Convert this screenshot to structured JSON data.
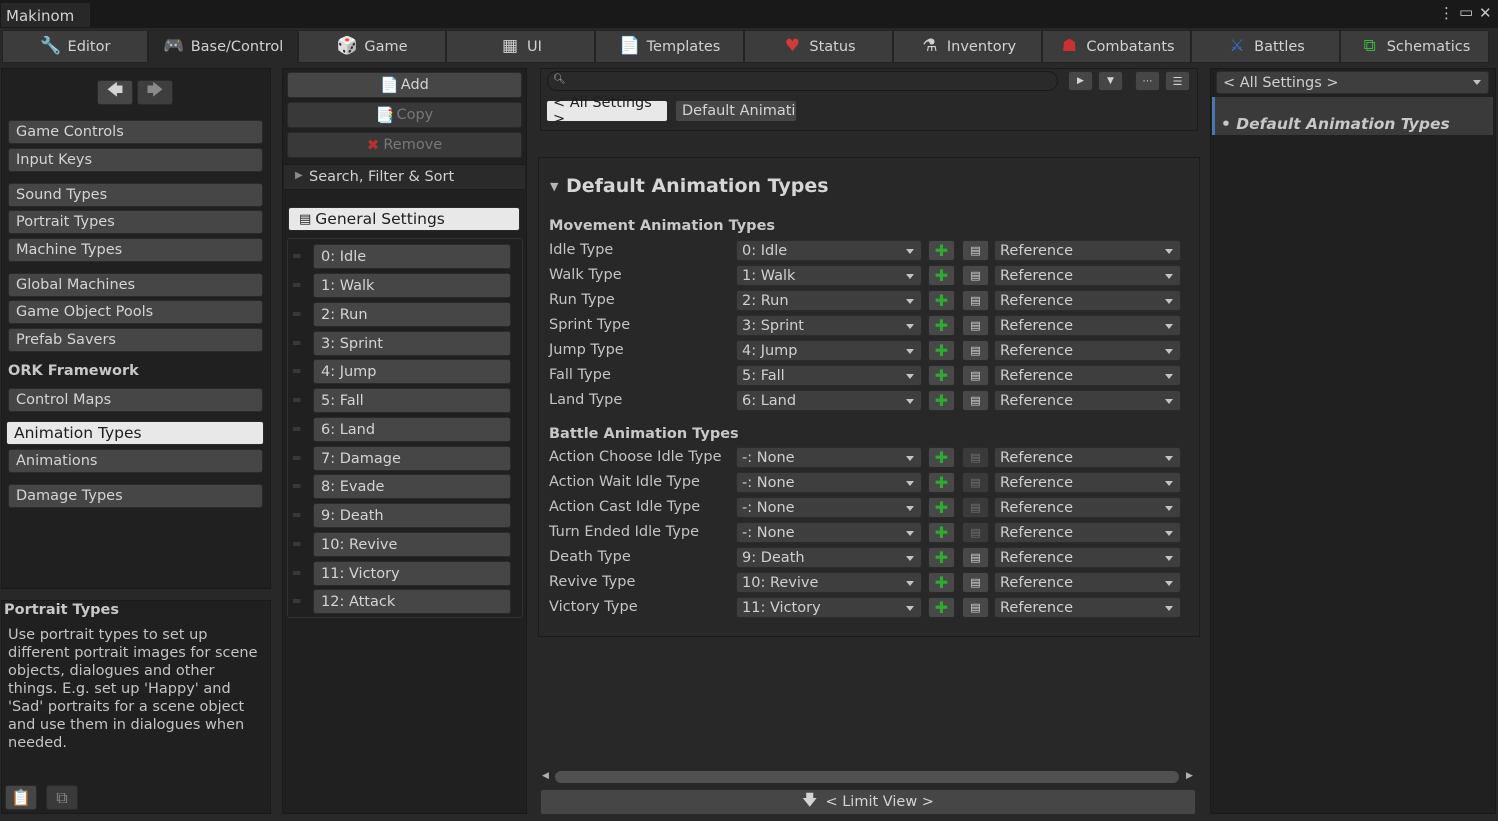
{
  "window": {
    "title": "Makinom"
  },
  "tabs": [
    {
      "label": "Editor",
      "icon": "wrench-icon"
    },
    {
      "label": "Base/Control",
      "icon": "gamepad-icon"
    },
    {
      "label": "Game",
      "icon": "dice-icon"
    },
    {
      "label": "UI",
      "icon": "ui-icon"
    },
    {
      "label": "Templates",
      "icon": "document-icon"
    },
    {
      "label": "Status",
      "icon": "heart-shield-icon"
    },
    {
      "label": "Inventory",
      "icon": "potion-icon"
    },
    {
      "label": "Combatants",
      "icon": "combatant-icon"
    },
    {
      "label": "Battles",
      "icon": "crossed-swords-icon"
    },
    {
      "label": "Schematics",
      "icon": "schematic-icon"
    }
  ],
  "sidebar": {
    "items": [
      {
        "label": "Game Controls"
      },
      {
        "label": "Input Keys"
      },
      {
        "label": "Sound Types"
      },
      {
        "label": "Portrait Types"
      },
      {
        "label": "Machine Types"
      },
      {
        "label": "Global Machines"
      },
      {
        "label": "Game Object Pools"
      },
      {
        "label": "Prefab Savers"
      },
      {
        "label": "ORK Framework"
      },
      {
        "label": "Control Maps"
      },
      {
        "label": "Animation Types"
      },
      {
        "label": "Animations"
      },
      {
        "label": "Damage Types"
      }
    ],
    "selected": "Animation Types"
  },
  "help": {
    "title": "Portrait Types",
    "body": "Use portrait types to set up different portrait images for scene objects, dialogues and other things. E.g. set up 'Happy' and 'Sad' portraits for a scene object and use them in dialogues when needed."
  },
  "listpanel": {
    "add_label": "Add",
    "copy_label": "Copy",
    "remove_label": "Remove",
    "search_label": "Search, Filter & Sort",
    "general_label": "General Settings",
    "items": [
      "0: Idle",
      "1: Walk",
      "2: Run",
      "3: Sprint",
      "4: Jump",
      "5: Fall",
      "6: Land",
      "7: Damage",
      "8: Evade",
      "9: Death",
      "10: Revive",
      "11: Victory",
      "12: Attack"
    ]
  },
  "main": {
    "search_placeholder": "",
    "breadcrumb_all": "< All Settings >",
    "breadcrumb_current": "Default Animati",
    "section_title": "Default Animation Types",
    "movement_header": "Movement Animation Types",
    "battle_header": "Battle Animation Types",
    "movement_rows": [
      {
        "label": "Idle Type",
        "value": "0: Idle",
        "ref": "Reference"
      },
      {
        "label": "Walk Type",
        "value": "1: Walk",
        "ref": "Reference"
      },
      {
        "label": "Run Type",
        "value": "2: Run",
        "ref": "Reference"
      },
      {
        "label": "Sprint Type",
        "value": "3: Sprint",
        "ref": "Reference"
      },
      {
        "label": "Jump Type",
        "value": "4: Jump",
        "ref": "Reference"
      },
      {
        "label": "Fall Type",
        "value": "5: Fall",
        "ref": "Reference"
      },
      {
        "label": "Land Type",
        "value": "6: Land",
        "ref": "Reference"
      }
    ],
    "battle_rows": [
      {
        "label": "Action Choose Idle Type",
        "value": "-: None",
        "ref": "Reference"
      },
      {
        "label": "Action Wait Idle Type",
        "value": "-: None",
        "ref": "Reference"
      },
      {
        "label": "Action Cast Idle Type",
        "value": "-: None",
        "ref": "Reference"
      },
      {
        "label": "Turn Ended Idle Type",
        "value": "-: None",
        "ref": "Reference"
      },
      {
        "label": "Death Type",
        "value": "9: Death",
        "ref": "Reference"
      },
      {
        "label": "Revive Type",
        "value": "10: Revive",
        "ref": "Reference"
      },
      {
        "label": "Victory Type",
        "value": "11: Victory",
        "ref": "Reference"
      }
    ],
    "limit_view_label": "< Limit View >"
  },
  "rightpanel": {
    "dropdown_label": "< All Settings >",
    "item_label": "• Default Animation Types"
  }
}
